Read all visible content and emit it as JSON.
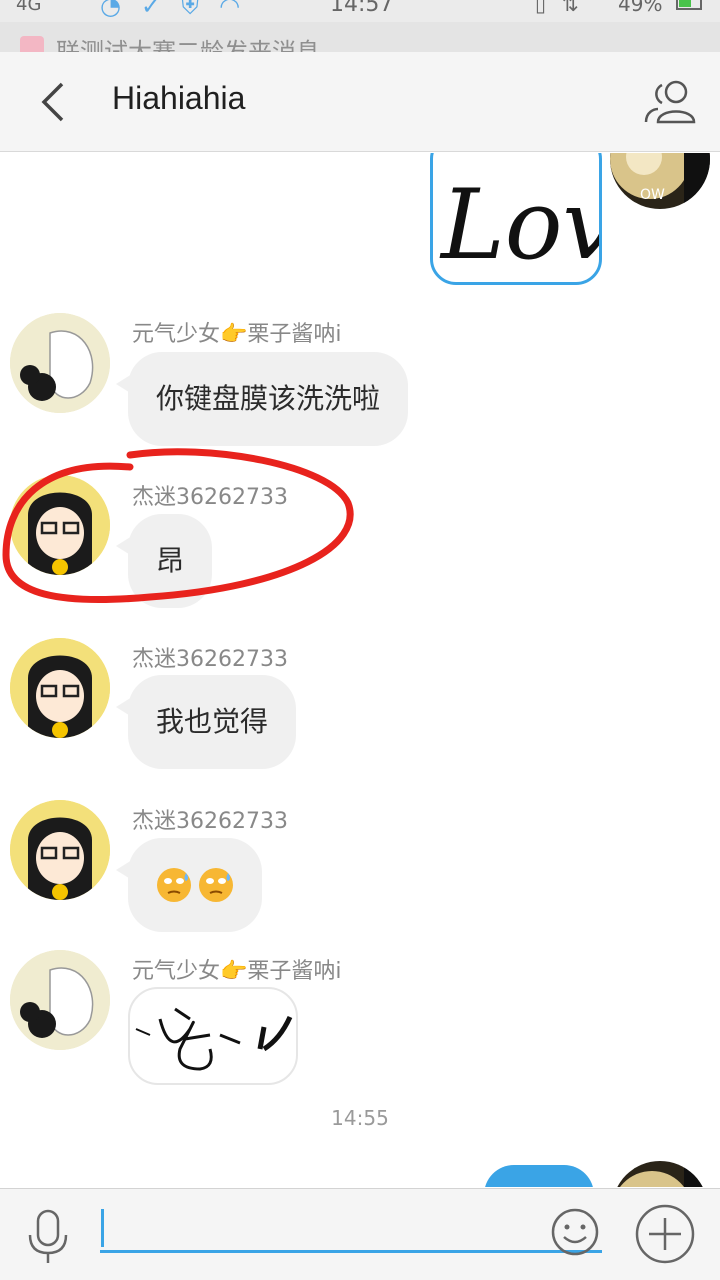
{
  "status_bar": {
    "network": "4G",
    "badge_count": "2",
    "time": "14:57",
    "battery": "49%"
  },
  "notification": {
    "text": "联测试大赛二龄发来消息"
  },
  "header": {
    "title": "Hiahiahia",
    "back_icon": "chevron-left-icon",
    "members_icon": "group-members-icon"
  },
  "messages": [
    {
      "type": "image",
      "side": "right",
      "sticker_text": "Love",
      "avatar_text": "OW"
    },
    {
      "type": "text",
      "side": "left",
      "sender": "元气少女👉栗子酱呐i",
      "text": "你键盘膜该洗洗啦"
    },
    {
      "type": "text",
      "side": "left",
      "sender": "杰迷36262733",
      "text": "昂"
    },
    {
      "type": "text",
      "side": "left",
      "sender": "杰迷36262733",
      "text": "我也觉得"
    },
    {
      "type": "emoji",
      "side": "left",
      "sender": "杰迷36262733",
      "emoji": "sweat-roll-eyes-emoji"
    },
    {
      "type": "image",
      "side": "left",
      "sender": "元气少女👉栗子酱呐i",
      "sticker": "handwritten-doodle"
    }
  ],
  "time_separator": "14:55",
  "input_bar": {
    "voice_icon": "microphone-icon",
    "emoji_icon": "smiley-icon",
    "plus_icon": "plus-icon",
    "placeholder": ""
  },
  "colors": {
    "accent": "#3aa4e6",
    "bubble_left": "#f0f0f0",
    "annotation": "#e8231d"
  }
}
